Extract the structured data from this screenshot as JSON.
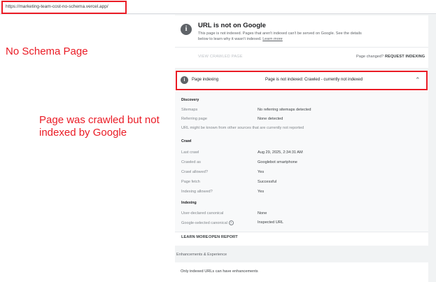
{
  "url_bar": {
    "url": "https://marketing-team-cost-no-schema.vercel.app/"
  },
  "annotations": {
    "no_schema": "No Schema Page",
    "crawled_note": "Page was crawled but not indexed by Google"
  },
  "status_card": {
    "icon": "info-icon",
    "title": "URL is not on Google",
    "description": "This page is not indexed. Pages that aren't indexed can't be served on Google. See the details below to learn why it wasn't indexed.",
    "learn_more": "Learn more",
    "view_crawled": "VIEW CRAWLED PAGE",
    "page_changed": "Page changed?",
    "request_indexing": "REQUEST INDEXING"
  },
  "page_indexing": {
    "label": "Page indexing",
    "status": "Page is not indexed: Crawled - currently not indexed",
    "discovery": {
      "heading": "Discovery",
      "rows": [
        {
          "label": "Sitemaps",
          "value": "No referring sitemaps detected"
        },
        {
          "label": "Referring page",
          "value": "None detected"
        }
      ],
      "note": "URL might be known from other sources that are currently not reported"
    },
    "crawl": {
      "heading": "Crawl",
      "rows": [
        {
          "label": "Last crawl",
          "value": "Aug 29, 2025, 2:34:31 AM"
        },
        {
          "label": "Crawled as",
          "value": "Googlebot smartphone"
        },
        {
          "label": "Crawl allowed?",
          "value": "Yes"
        },
        {
          "label": "Page fetch",
          "value": "Successful"
        },
        {
          "label": "Indexing allowed?",
          "value": "Yes"
        }
      ]
    },
    "indexing": {
      "heading": "Indexing",
      "rows": [
        {
          "label": "User-declared canonical",
          "value": "None"
        },
        {
          "label": "Google-selected canonical",
          "value": "Inspected URL"
        }
      ]
    },
    "learn_more": "LEARN MORE",
    "open_report": "OPEN REPORT"
  },
  "enhancements": {
    "label": "Enhancements & Experience",
    "message": "Only indexed URLs can have enhancements"
  },
  "colors": {
    "annotation_red": "#ea1b25",
    "panel_bg": "#f1f3f4"
  }
}
